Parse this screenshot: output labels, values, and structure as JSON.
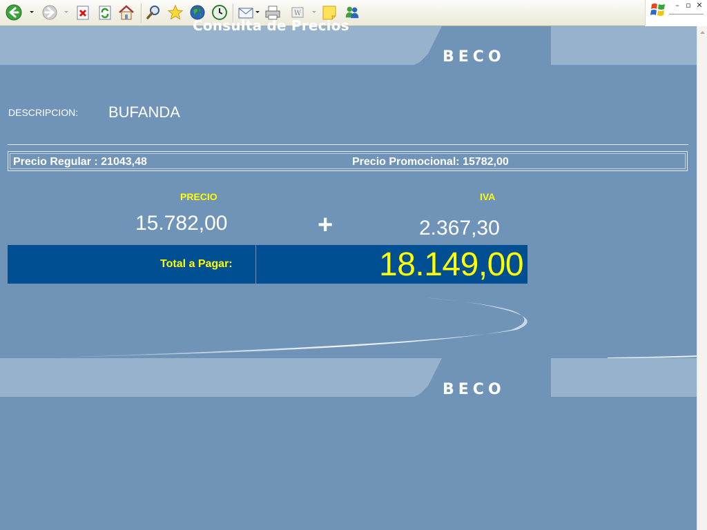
{
  "browser": {
    "toolbar": {
      "buttons": [
        {
          "name": "back-button",
          "icon": "back-arrow-icon"
        },
        {
          "name": "forward-button",
          "icon": "forward-arrow-icon"
        },
        {
          "name": "stop-button",
          "icon": "stop-icon"
        },
        {
          "name": "refresh-button",
          "icon": "refresh-icon"
        },
        {
          "name": "home-button",
          "icon": "home-icon"
        },
        {
          "name": "search-button",
          "icon": "search-icon"
        },
        {
          "name": "favorites-button",
          "icon": "star-icon"
        },
        {
          "name": "media-button",
          "icon": "globe-icon"
        },
        {
          "name": "history-button",
          "icon": "history-icon"
        },
        {
          "name": "mail-button",
          "icon": "mail-icon"
        },
        {
          "name": "print-button",
          "icon": "printer-icon"
        },
        {
          "name": "edit-button",
          "icon": "word-edit-icon"
        },
        {
          "name": "discuss-button",
          "icon": "note-icon"
        },
        {
          "name": "messenger-button",
          "icon": "messenger-icon"
        }
      ],
      "window_controls": {
        "minimize": "–",
        "restore": "▫",
        "close": "✕"
      }
    }
  },
  "page": {
    "header": {
      "title": "Consulta de Precios",
      "logo": "BECO"
    },
    "footer": {
      "logo": "BECO"
    },
    "product": {
      "description_label": "DESCRIPCION:",
      "description_value": "BUFANDA"
    },
    "prices": {
      "regular": "Precio Regular : 21043,48",
      "promo": "Precio Promocional: 15782,00"
    },
    "breakdown": {
      "price_label": "PRECIO",
      "price_value": "15.782,00",
      "plus": "+",
      "iva_label": "IVA",
      "iva_value": "2.367,30"
    },
    "total": {
      "label": "Total a Pagar:",
      "value": "18.149,00"
    },
    "colors": {
      "background": "#7093b8",
      "band": "#97b2cc",
      "total_bar": "#004f92",
      "highlight": "#ffff00"
    }
  }
}
